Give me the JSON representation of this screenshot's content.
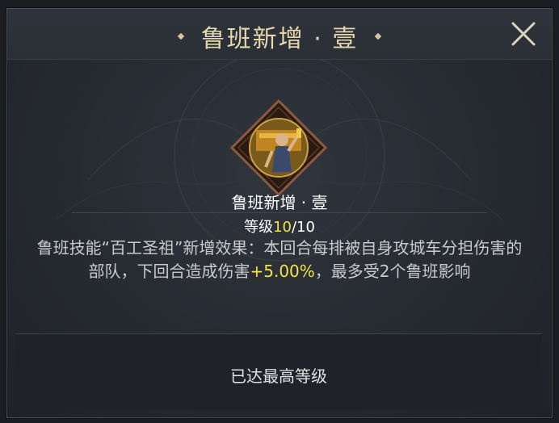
{
  "dialog": {
    "title": "鲁班新增 · 壹",
    "close_icon": "close-icon"
  },
  "skill": {
    "icon": "luban-portrait-icon",
    "name": "鲁班新增 · 壹",
    "level_label": "等级",
    "level_current": "10",
    "level_max": "/10",
    "description_part1": "鲁班技能“百工圣祖”新增效果：本回合每排被自身攻城车分担伤害的部队，下回合造成伤害",
    "description_highlight": "+5.00%",
    "description_part2": "，最多受2个鲁班影响"
  },
  "footer": {
    "status_text": "已达最高等级"
  },
  "colors": {
    "title_gold": "#e6d8ae",
    "highlight_yellow": "#f4e34a",
    "frame_brown": "#8a5a3c"
  }
}
